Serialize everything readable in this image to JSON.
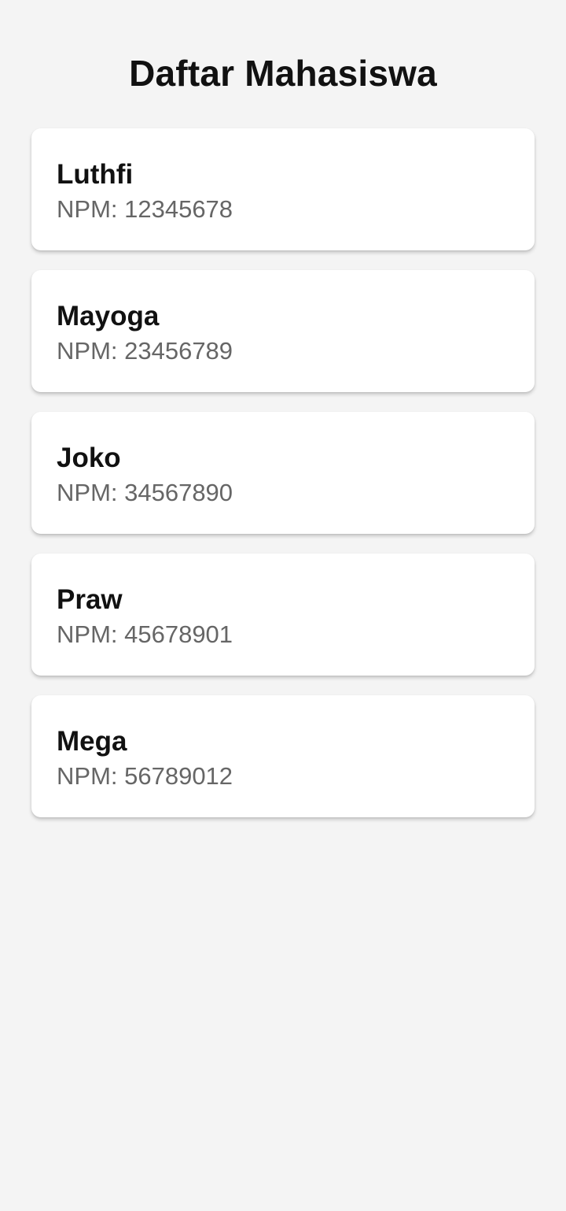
{
  "page": {
    "title": "Daftar Mahasiswa"
  },
  "students": [
    {
      "name": "Luthfi",
      "npm": "NPM: 12345678"
    },
    {
      "name": "Mayoga",
      "npm": "NPM: 23456789"
    },
    {
      "name": "Joko",
      "npm": "NPM: 34567890"
    },
    {
      "name": "Praw",
      "npm": "NPM: 45678901"
    },
    {
      "name": "Mega",
      "npm": "NPM: 56789012"
    }
  ],
  "colors": {
    "background": "#f4f4f4",
    "card": "#ffffff",
    "title_text": "#111111",
    "secondary_text": "#666666"
  }
}
